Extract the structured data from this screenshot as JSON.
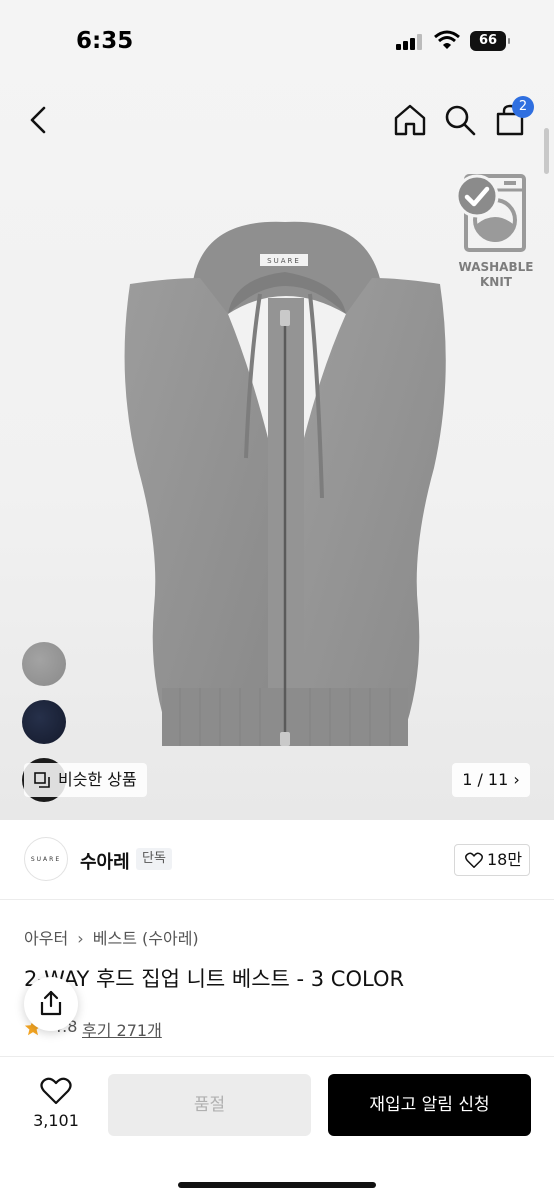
{
  "status_bar": {
    "time": "6:35",
    "battery": "66"
  },
  "nav": {
    "cart_count": "2"
  },
  "badge": {
    "line1": "WASHABLE",
    "line2": "KNIT"
  },
  "product_image": {
    "tag_text": "SUARE"
  },
  "gallery": {
    "similar_label": "비슷한 상품",
    "pager": "1 / 11",
    "swatches": [
      {
        "name": "grey",
        "color": "#939393"
      },
      {
        "name": "navy",
        "color": "#1c2337"
      },
      {
        "name": "black",
        "color": "#1a1a1a"
      }
    ]
  },
  "brand": {
    "logo_text": "SUARE",
    "name": "수아레",
    "tag": "단독",
    "likes": "18만"
  },
  "product": {
    "breadcrumb": [
      "아우터",
      "베스트 (수아레)"
    ],
    "title": "2-WAY 후드 집업 니트 베스트 - 3 COLOR",
    "rating": "4.8",
    "reviews": "후기 271개"
  },
  "bottom_bar": {
    "wish_count": "3,101",
    "soldout_label": "품절",
    "restock_label": "재입고 알림 신청"
  },
  "colors": {
    "accent": "#2f6fe0",
    "primary_button": "#000000",
    "star": "#f5a623"
  }
}
